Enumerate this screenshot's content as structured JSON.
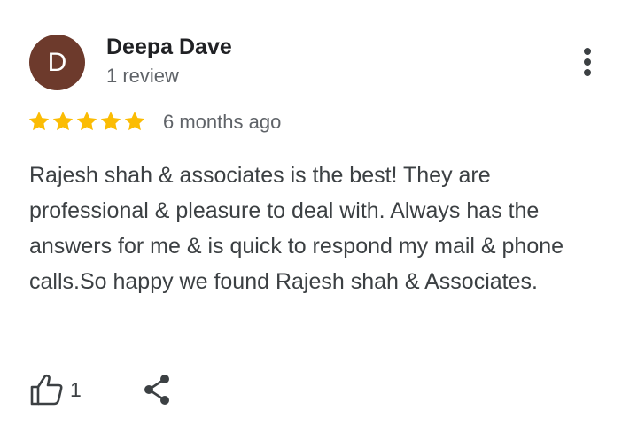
{
  "reviewer": {
    "avatar_letter": "D",
    "avatar_color": "#6d3a2c",
    "name": "Deepa Dave",
    "review_count": "1 review"
  },
  "rating": {
    "stars": 5,
    "max_stars": 5,
    "star_color": "#fbbc04"
  },
  "time_ago": "6 months ago",
  "review_text": "Rajesh shah & associates is the best! They are professional & pleasure to deal with. Always has the answers for me & is quick to respond my mail & phone calls.So happy we found Rajesh shah & Associates.",
  "actions": {
    "like_icon": "thumbs-up-icon",
    "like_count": "1",
    "share_icon": "share-icon",
    "more_icon": "more-vert-icon"
  }
}
